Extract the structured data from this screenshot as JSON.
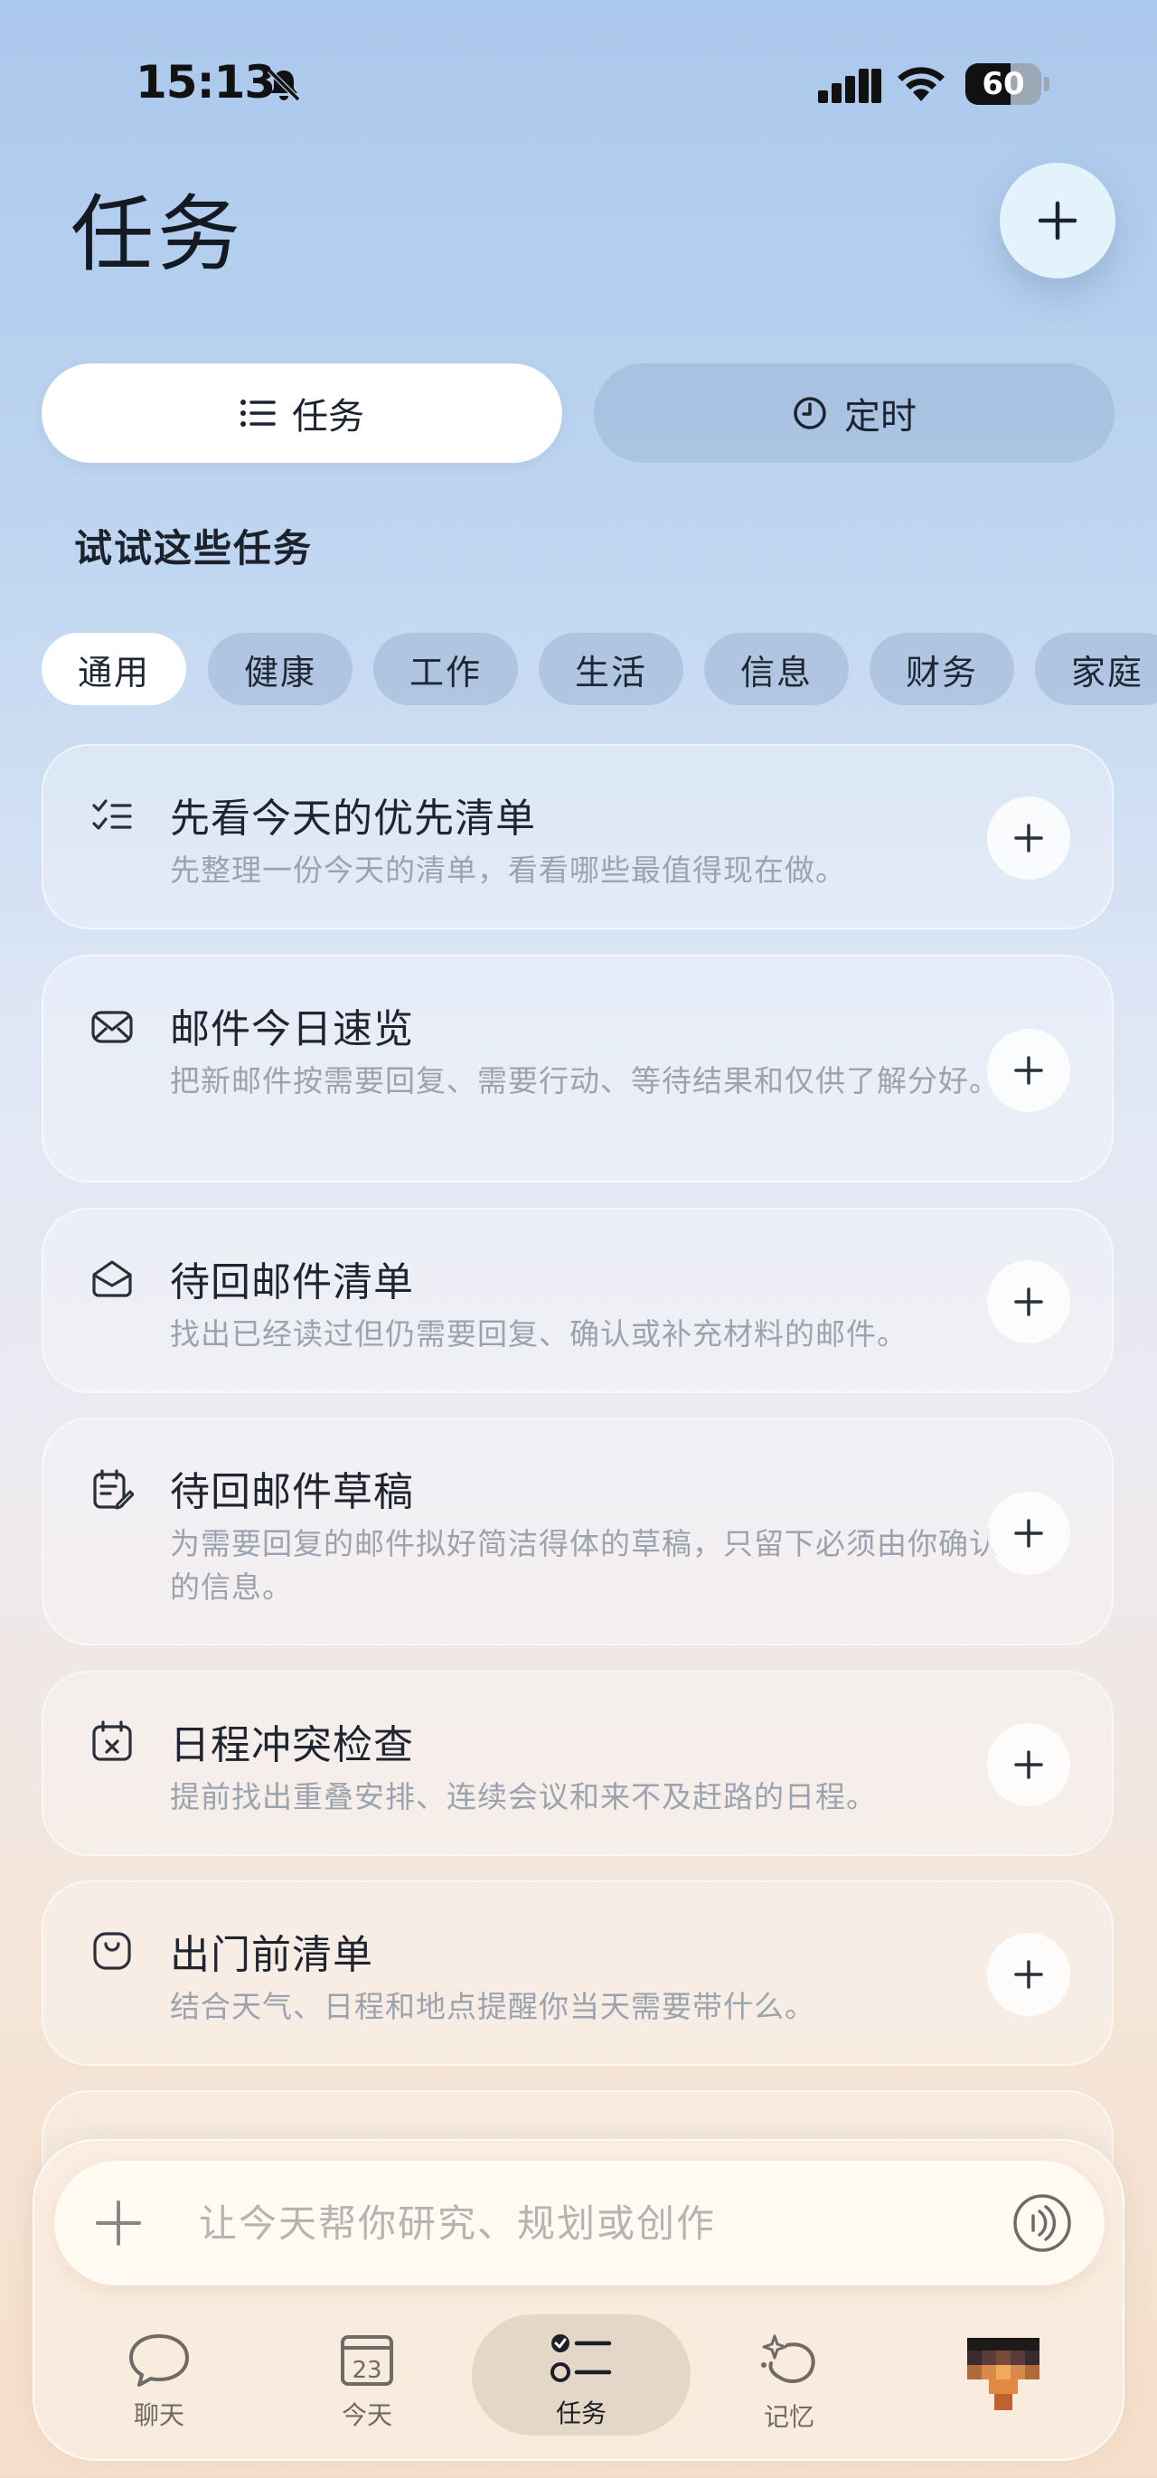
{
  "status_bar": {
    "time": "15:13",
    "battery": "60",
    "battery_level": 0.6
  },
  "header": {
    "title": "任务"
  },
  "segments": {
    "tasks": "任务",
    "timer": "定时"
  },
  "section_title": "试试这些任务",
  "chips": [
    "通用",
    "健康",
    "工作",
    "生活",
    "信息",
    "财务",
    "家庭"
  ],
  "cards": [
    {
      "icon": "checklist-icon",
      "title": "先看今天的优先清单",
      "desc": "先整理一份今天的清单，看看哪些最值得现在做。"
    },
    {
      "icon": "mail-icon",
      "title": "邮件今日速览",
      "desc": "把新邮件按需要回复、需要行动、等待结果和仅供了解分好。"
    },
    {
      "icon": "open-mail-icon",
      "title": "待回邮件清单",
      "desc": "找出已经读过但仍需要回复、确认或补充材料的邮件。"
    },
    {
      "icon": "draft-icon",
      "title": "待回邮件草稿",
      "desc": "为需要回复的邮件拟好简洁得体的草稿，只留下必须由你确认的信息。"
    },
    {
      "icon": "calendar-conflict-icon",
      "title": "日程冲突检查",
      "desc": "提前找出重叠安排、连续会议和来不及赶路的日程。"
    },
    {
      "icon": "bag-icon",
      "title": "出门前清单",
      "desc": "结合天气、日程和地点提醒你当天需要带什么。"
    }
  ],
  "composer": {
    "placeholder": "让今天帮你研究、规划或创作"
  },
  "tabs": {
    "chat": "聊天",
    "today": "今天",
    "today_date": "23",
    "tasks": "任务",
    "memory": "记忆"
  }
}
